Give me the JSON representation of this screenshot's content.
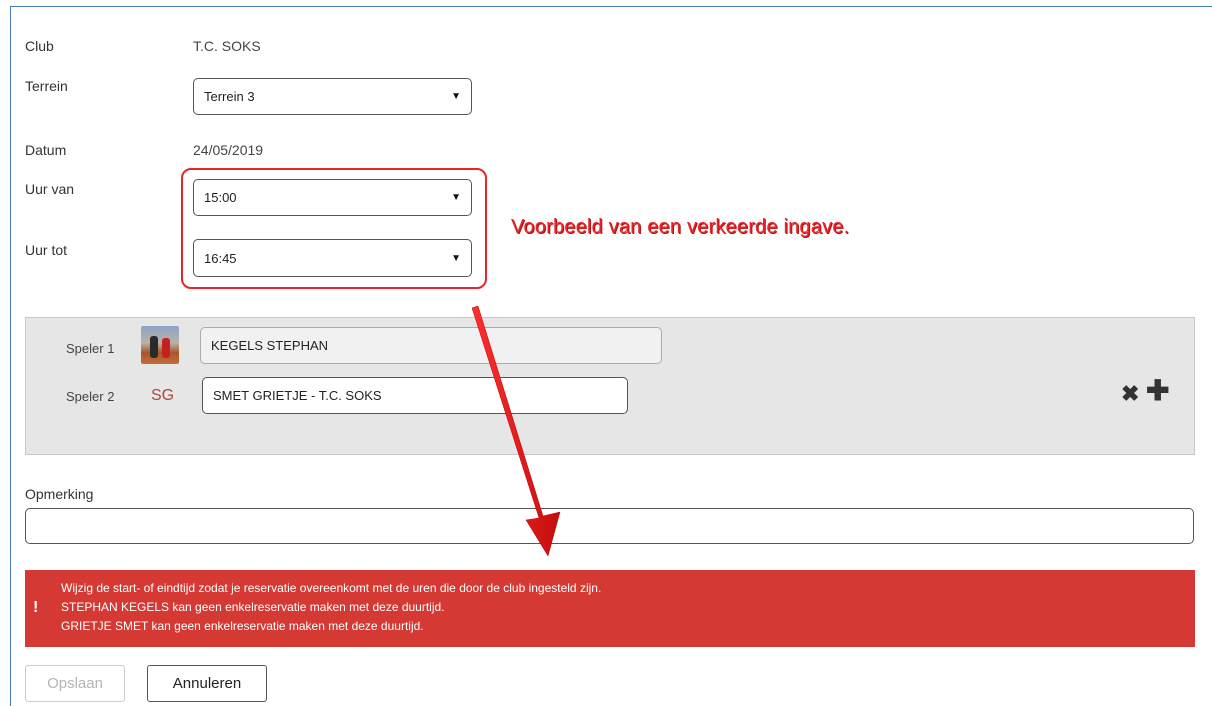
{
  "form": {
    "club_label": "Club",
    "club_value": "T.C. SOKS",
    "terrein_label": "Terrein",
    "terrein_value": "Terrein 3",
    "datum_label": "Datum",
    "datum_value": "24/05/2019",
    "uur_van_label": "Uur van",
    "uur_van_value": "15:00",
    "uur_tot_label": "Uur tot",
    "uur_tot_value": "16:45"
  },
  "annotation": "Voorbeeld van een verkeerde ingave.",
  "players": {
    "speler1_label": "Speler 1",
    "speler1_value": "KEGELS STEPHAN",
    "speler2_label": "Speler 2",
    "speler2_initials": "SG",
    "speler2_value": "SMET GRIETJE - T.C. SOKS"
  },
  "opmerking": {
    "label": "Opmerking",
    "value": ""
  },
  "alert": {
    "icon": "!",
    "lines": [
      "Wijzig de start- of eindtijd zodat je reservatie overeenkomt met de uren die door de club ingesteld zijn.",
      "STEPHAN KEGELS kan geen enkelreservatie maken met deze duurtijd.",
      "GRIETJE SMET kan geen enkelreservatie maken met deze duurtijd."
    ],
    "color": "#d43a33"
  },
  "buttons": {
    "save": "Opslaan",
    "cancel": "Annuleren"
  },
  "accent_color": "#e8252a"
}
